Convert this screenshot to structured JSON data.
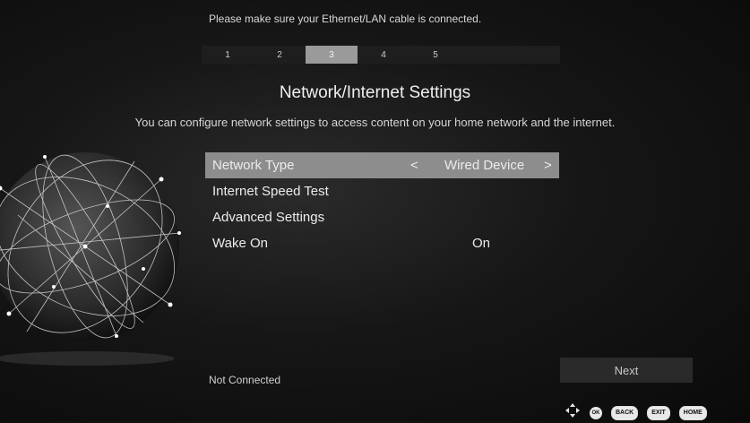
{
  "header": {
    "notice": "Please make sure your Ethernet/LAN cable is connected."
  },
  "steps": [
    {
      "label": "1",
      "active": false
    },
    {
      "label": "2",
      "active": false
    },
    {
      "label": "3",
      "active": true
    },
    {
      "label": "4",
      "active": false
    },
    {
      "label": "5",
      "active": false
    }
  ],
  "page": {
    "title": "Network/Internet Settings",
    "subtitle": "You can configure network settings to access content on your home network and the internet."
  },
  "menu": {
    "items": [
      {
        "label": "Network Type",
        "value": "Wired Device",
        "selected": true
      },
      {
        "label": "Internet Speed Test",
        "value": ""
      },
      {
        "label": "Advanced Settings",
        "value": ""
      },
      {
        "label": "Wake On",
        "value": "On"
      }
    ],
    "arrow_left": "<",
    "arrow_right": ">"
  },
  "footer": {
    "status": "Not Connected",
    "next_label": "Next",
    "hints": {
      "nav": "navigation-arrows-icon",
      "ok": "OK",
      "back": "BACK",
      "exit": "EXIT",
      "home": "HOME"
    }
  },
  "colors": {
    "selected_bg": "#8d8d8d",
    "active_step_bg": "#9a9a9a"
  }
}
